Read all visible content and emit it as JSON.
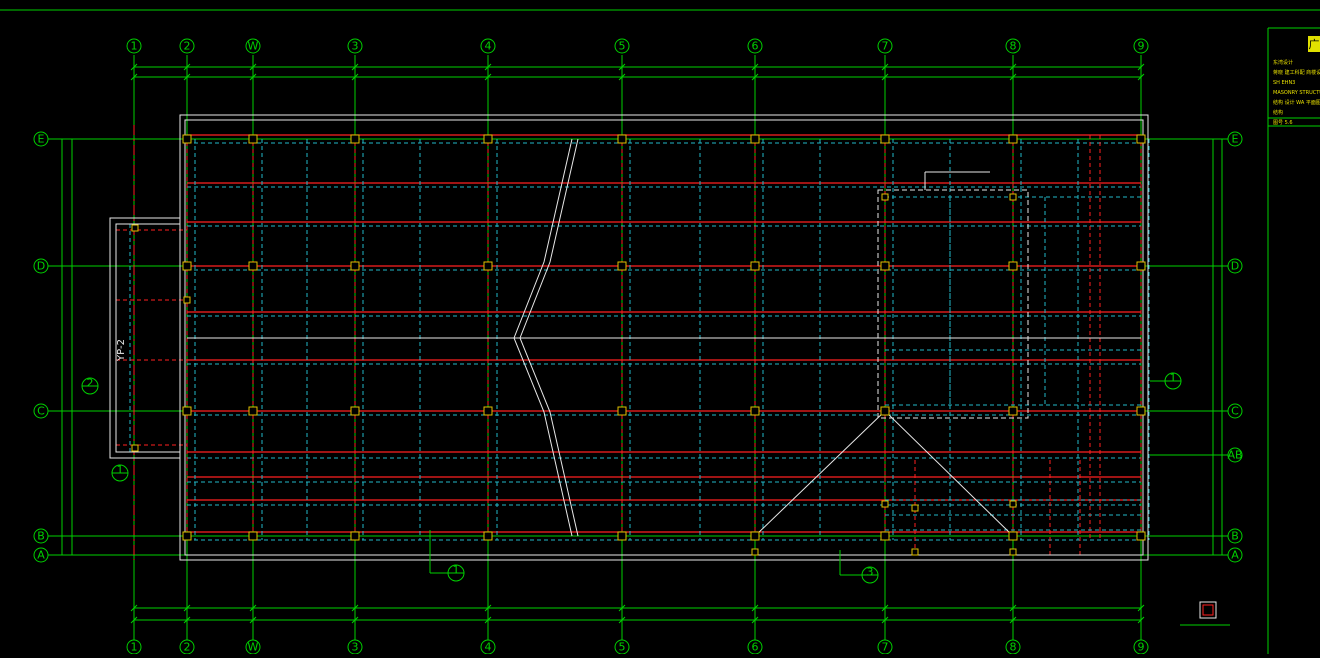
{
  "drawing": {
    "grid_cols": [
      "1",
      "2",
      "W",
      "3",
      "4",
      "5",
      "6",
      "7",
      "8",
      "9"
    ],
    "grid_rows": [
      "E",
      "D",
      "C",
      "B",
      "A"
    ],
    "secondary_row_label": "AB",
    "elevation_label": "YP-2",
    "callout_labels": [
      "2",
      "1",
      "1",
      "3",
      "1"
    ],
    "title_block": {
      "logo_char": "广",
      "lines": [
        "东湾设计",
        "蒋晓 建工科配 商楼设计",
        "SH EHN3",
        "MASONRY STRUCTURAL DESIGN",
        "结构  设计  WA 平面图",
        "结构",
        "图号  5.6"
      ]
    }
  },
  "colors": {
    "grid": "#00d000",
    "beam": "#ff2020",
    "secondary_beam": "#22b8c8",
    "wall": "#e8e8e8",
    "column": "#e0c000",
    "background": "#000000"
  }
}
